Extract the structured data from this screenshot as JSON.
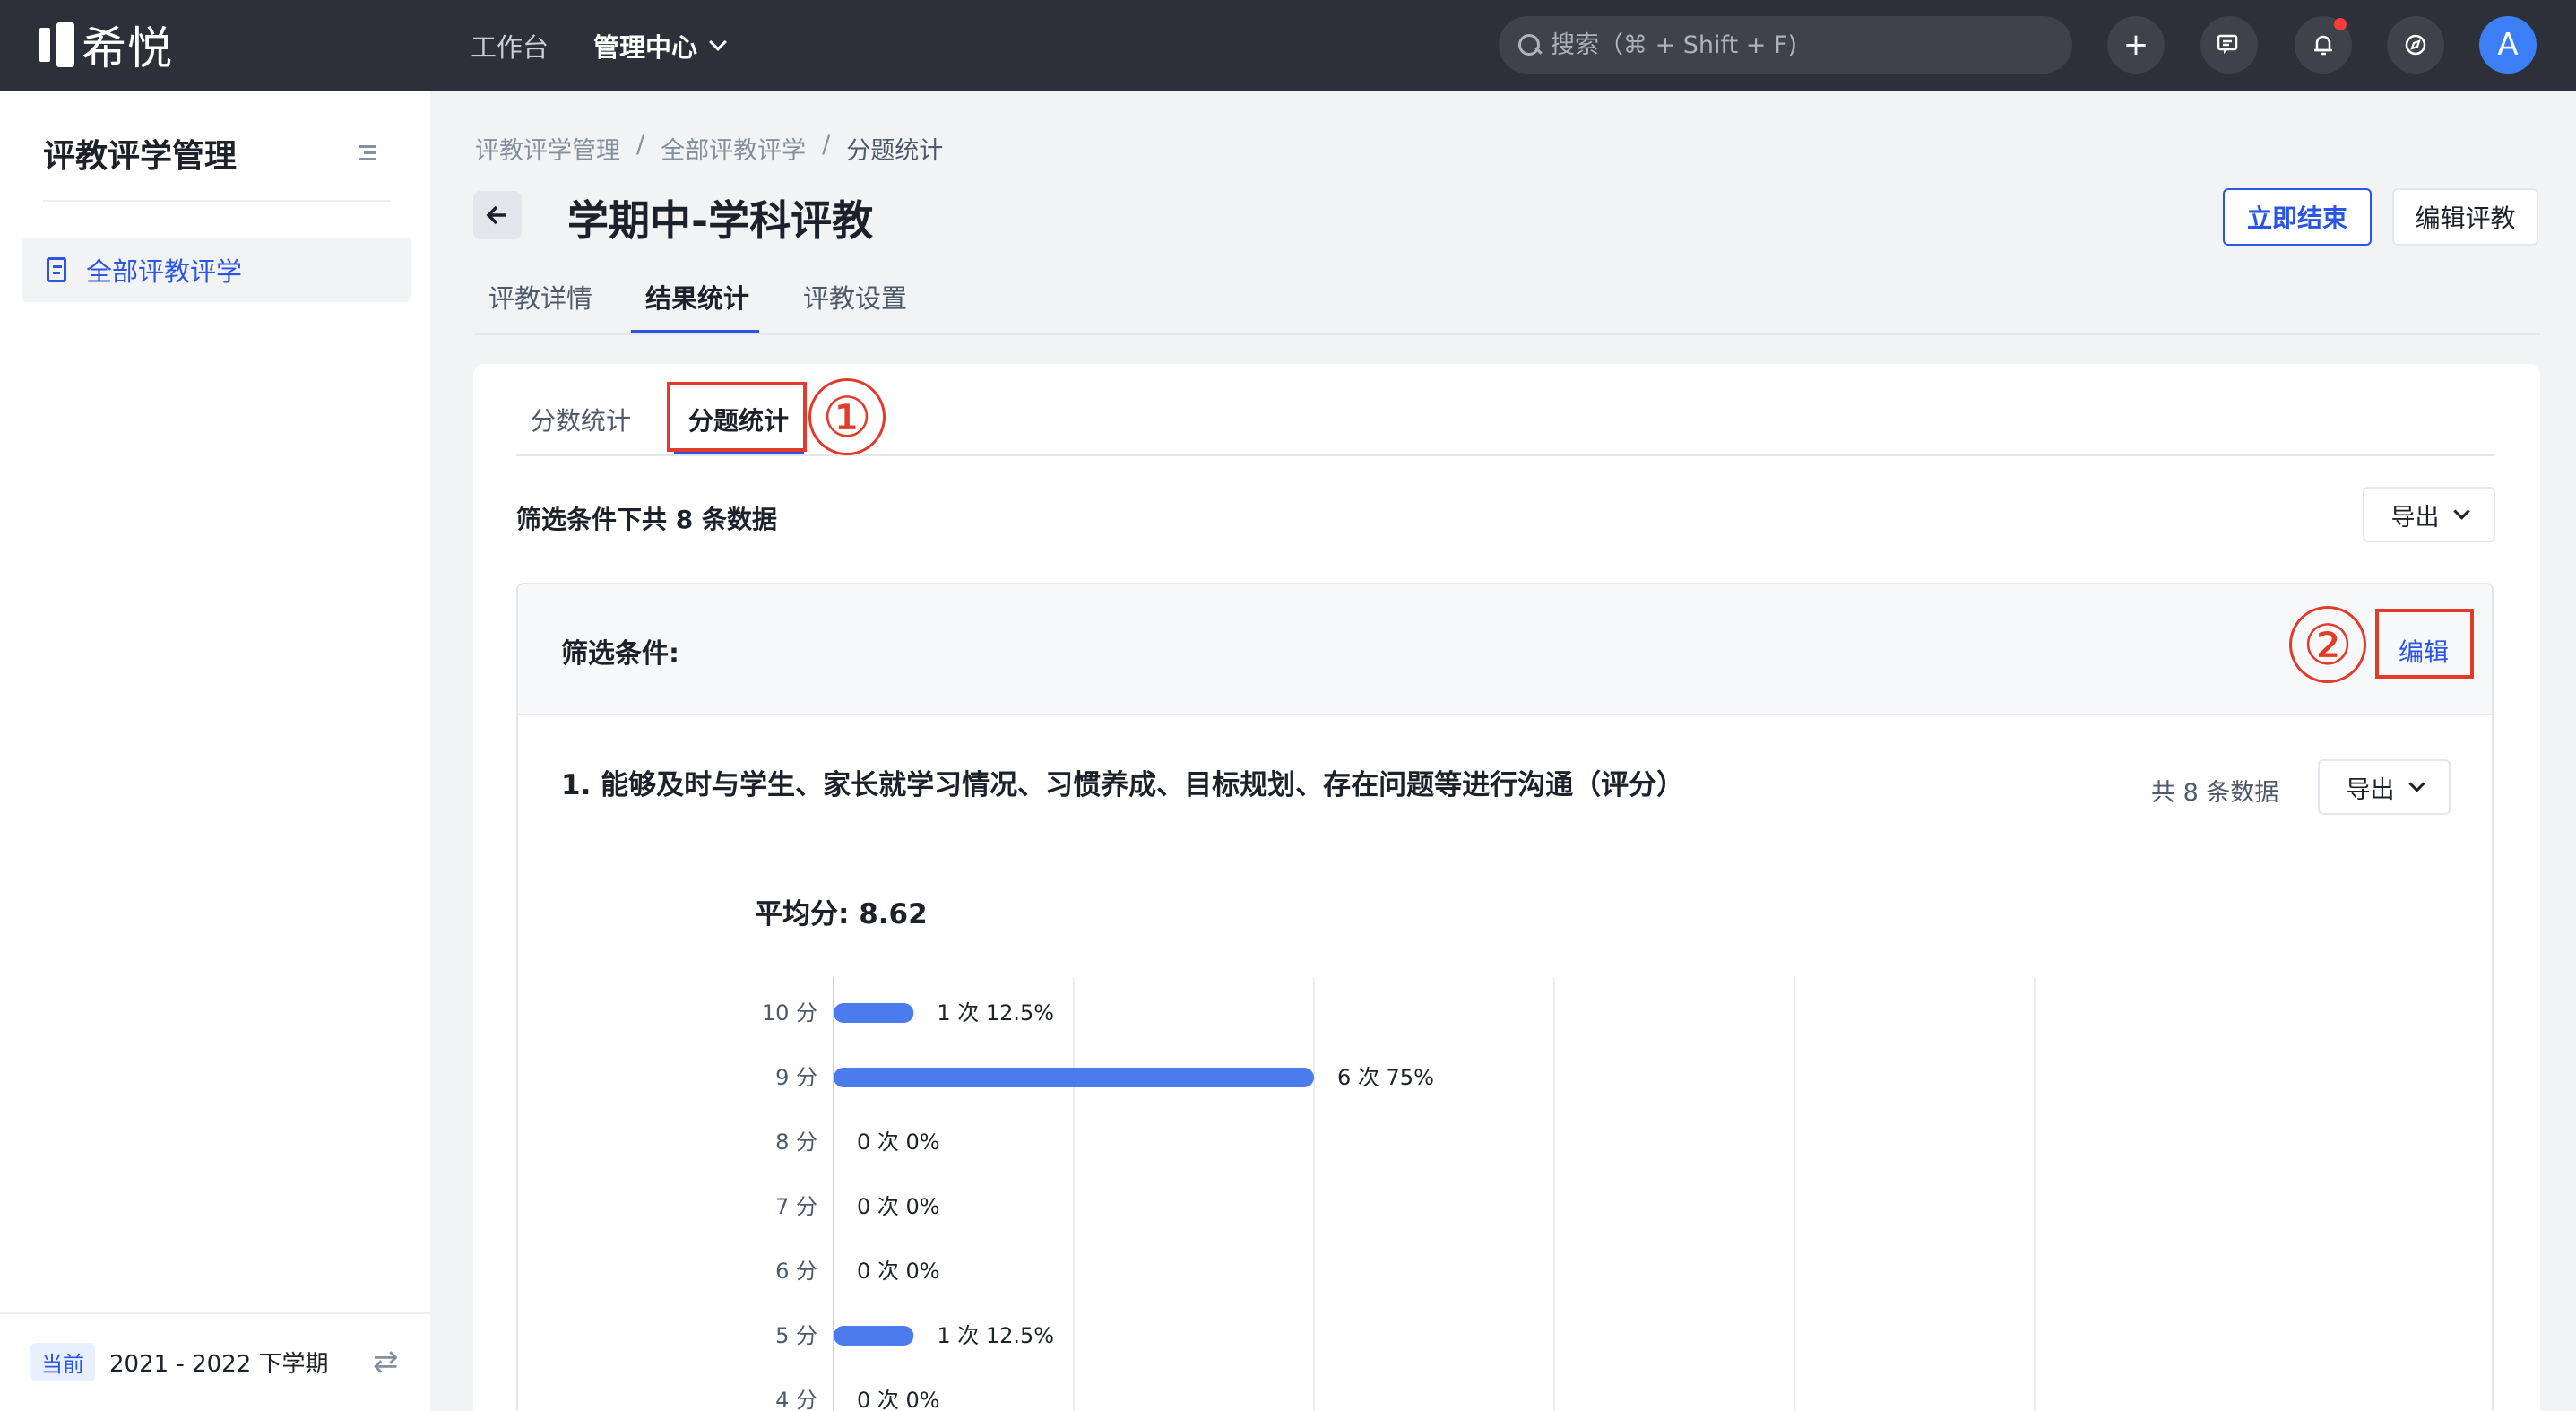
{
  "brand": {
    "name": "希悦"
  },
  "topnav": {
    "items": [
      "工作台",
      "管理中心"
    ]
  },
  "search": {
    "placeholder": "搜索（⌘ + Shift + F)"
  },
  "toolbar": {
    "add": "+",
    "avatar_letter": "A"
  },
  "sidebar": {
    "title": "评教评学管理",
    "items": [
      {
        "label": "全部评教评学"
      }
    ],
    "footer": {
      "tag": "当前",
      "term": "2021 - 2022 下学期"
    }
  },
  "breadcrumb": [
    "评教评学管理",
    "全部评教评学",
    "分题统计"
  ],
  "breadcrumb_sep": "/",
  "page": {
    "title": "学期中-学科评教",
    "end_button": "立即结束",
    "edit_button": "编辑评教",
    "tabs": [
      "评教详情",
      "结果统计",
      "评教设置"
    ]
  },
  "subtabs": [
    "分数统计",
    "分题统计"
  ],
  "annotations": [
    "①",
    "②"
  ],
  "summary": {
    "count_text": "筛选条件下共 8 条数据",
    "export": "导出"
  },
  "filter": {
    "label": "筛选条件:",
    "edit": "编辑"
  },
  "question": {
    "title": "1. 能够及时与学生、家长就学习情况、习惯养成、目标规划、存在问题等进行沟通（评分）",
    "count": "共 8 条数据",
    "export": "导出",
    "avg": "平均分: 8.62"
  },
  "chart_data": {
    "type": "bar",
    "orientation": "horizontal",
    "categories": [
      "10 分",
      "9 分",
      "8 分",
      "7 分",
      "6 分",
      "5 分",
      "4 分"
    ],
    "values": [
      1,
      6,
      0,
      0,
      0,
      1,
      0
    ],
    "data_labels": [
      "1 次 12.5%",
      "6 次 75%",
      "0 次 0%",
      "0 次 0%",
      "0 次 0%",
      "1 次 12.5%",
      "0 次 0%"
    ],
    "xlim": [
      0,
      15
    ],
    "grid": true,
    "bar_color": "#4b7bec"
  }
}
